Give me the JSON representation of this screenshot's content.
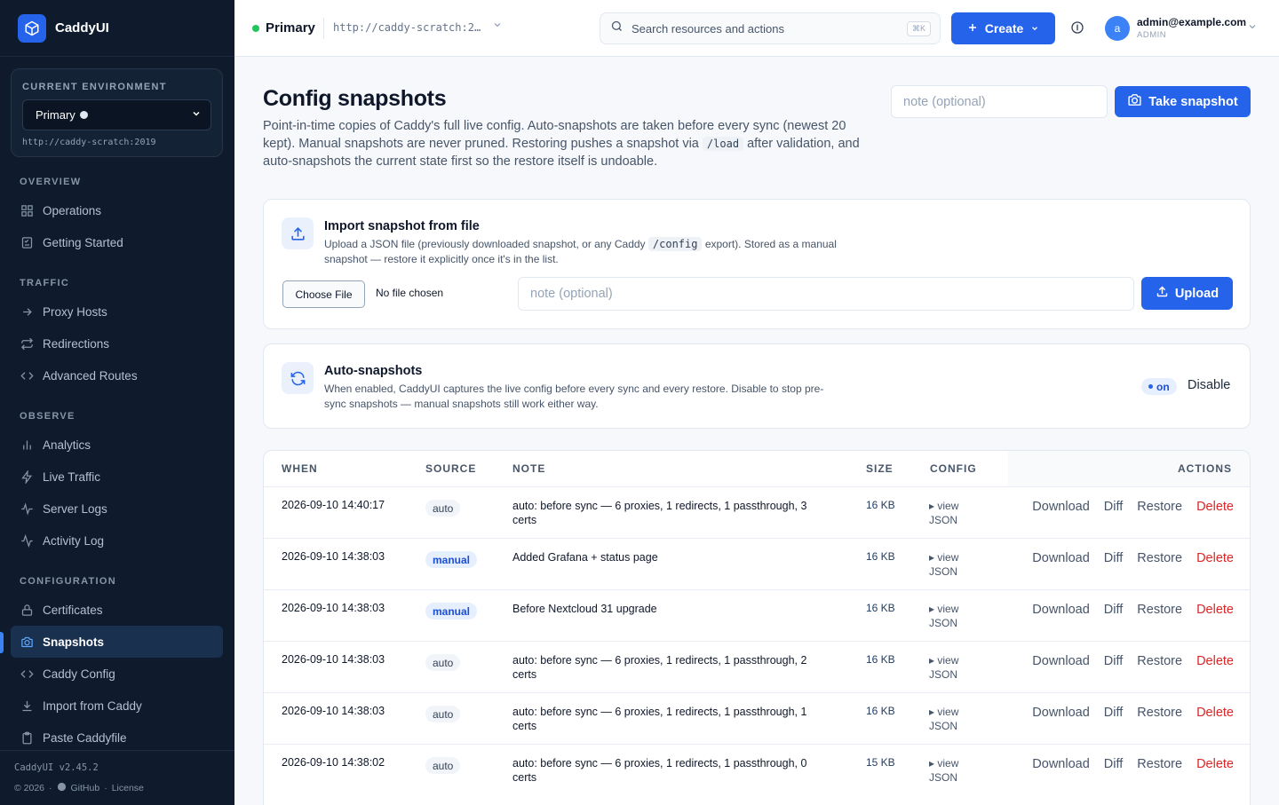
{
  "app": {
    "name": "CaddyUI",
    "version": "CaddyUI v2.45.2"
  },
  "sidebar": {
    "env_label": "CURRENT ENVIRONMENT",
    "env_name": "Primary",
    "env_url": "http://caddy-scratch:2019",
    "sections": {
      "overview": "OVERVIEW",
      "traffic": "TRAFFIC",
      "observe": "OBSERVE",
      "configuration": "CONFIGURATION"
    },
    "items": {
      "operations": "Operations",
      "getting_started": "Getting Started",
      "proxy_hosts": "Proxy Hosts",
      "redirections": "Redirections",
      "advanced_routes": "Advanced Routes",
      "analytics": "Analytics",
      "live_traffic": "Live Traffic",
      "server_logs": "Server Logs",
      "activity_log": "Activity Log",
      "certificates": "Certificates",
      "snapshots": "Snapshots",
      "caddy_config": "Caddy Config",
      "import_from_caddy": "Import from Caddy",
      "paste_caddyfile": "Paste Caddyfile"
    },
    "footer": {
      "copyright": "© 2026",
      "github": "GitHub",
      "license": "License"
    }
  },
  "topbar": {
    "env_name": "Primary",
    "env_url": "http://caddy-scratch:2…",
    "search_placeholder": "Search resources and actions",
    "search_shortcut": "⌘K",
    "create_label": "Create",
    "user_email": "admin@example.com",
    "user_role": "ADMIN",
    "avatar_letter": "a"
  },
  "page": {
    "title": "Config snapshots",
    "desc_part1": "Point-in-time copies of Caddy's full live config. Auto-snapshots are taken before every sync (newest 20 kept). Manual snapshots are never pruned. Restoring pushes a snapshot via",
    "desc_code": "/load",
    "desc_part2": "after validation, and auto-snapshots the current state first so the restore itself is undoable.",
    "note_placeholder": "note (optional)",
    "take_snapshot_label": "Take snapshot"
  },
  "import_card": {
    "title": "Import snapshot from file",
    "desc_part1": "Upload a JSON file (previously downloaded snapshot, or any Caddy",
    "desc_code": "/config",
    "desc_part2": "export). Stored as a manual snapshot — restore it explicitly once it's in the list.",
    "choose_file_label": "Choose File",
    "no_file_label": "No file chosen",
    "note_placeholder": "note (optional)",
    "upload_label": "Upload"
  },
  "auto_card": {
    "title": "Auto-snapshots",
    "desc": "When enabled, CaddyUI captures the live config before every sync and every restore. Disable to stop pre-sync snapshots — manual snapshots still work either way.",
    "status": "on",
    "disable_label": "Disable"
  },
  "table": {
    "headers": {
      "when": "WHEN",
      "source": "SOURCE",
      "note": "NOTE",
      "size": "SIZE",
      "config": "CONFIG",
      "actions": "ACTIONS"
    },
    "view_json_label": "▸ view JSON",
    "actions": {
      "download": "Download",
      "diff": "Diff",
      "restore": "Restore",
      "delete": "Delete"
    },
    "rows": [
      {
        "when": "2026-09-10 14:40:17",
        "source": "auto",
        "note": "auto: before sync — 6 proxies, 1 redirects, 1 passthrough, 3 certs",
        "size": "16 KB"
      },
      {
        "when": "2026-09-10 14:38:03",
        "source": "manual",
        "note": "Added Grafana + status page",
        "size": "16 KB"
      },
      {
        "when": "2026-09-10 14:38:03",
        "source": "manual",
        "note": "Before Nextcloud 31 upgrade",
        "size": "16 KB"
      },
      {
        "when": "2026-09-10 14:38:03",
        "source": "auto",
        "note": "auto: before sync — 6 proxies, 1 redirects, 1 passthrough, 2 certs",
        "size": "16 KB"
      },
      {
        "when": "2026-09-10 14:38:03",
        "source": "auto",
        "note": "auto: before sync — 6 proxies, 1 redirects, 1 passthrough, 1 certs",
        "size": "16 KB"
      },
      {
        "when": "2026-09-10 14:38:02",
        "source": "auto",
        "note": "auto: before sync — 6 proxies, 1 redirects, 1 passthrough, 0 certs",
        "size": "15 KB"
      }
    ]
  },
  "colors": {
    "accent": "#2563eb",
    "sidebar_bg": "#0f1b2d",
    "danger": "#dc2626",
    "online": "#22c55e"
  }
}
